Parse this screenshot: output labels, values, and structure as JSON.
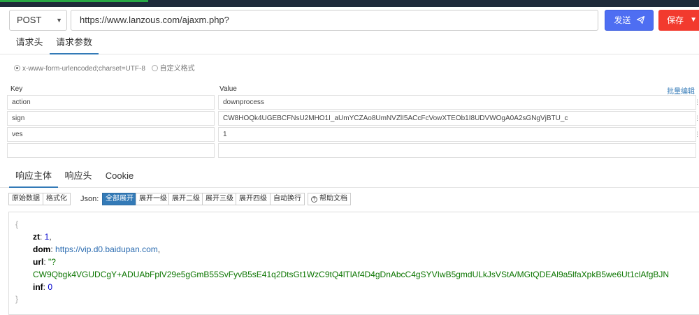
{
  "request": {
    "method": "POST",
    "url": "https://www.lanzous.com/ajaxm.php?",
    "send_label": "发送",
    "save_label": "保存"
  },
  "request_tabs": [
    "请求头",
    "请求参数"
  ],
  "body_types": [
    "x-www-form-urlencoded;charset=UTF-8",
    "自定义格式"
  ],
  "params": {
    "key_header": "Key",
    "value_header": "Value",
    "bulk_edit": "批量编辑",
    "rows": [
      {
        "key": "action",
        "value": "downprocess"
      },
      {
        "key": "sign",
        "value": "CW8HOQk4UGEBCFNsU2MHO1I_aUmYCZAo8UmNVZlI5ACcFcVowXTEOb1I8UDVWOgA0A2sGNgVjBTU_c"
      },
      {
        "key": "ves",
        "value": "1"
      },
      {
        "key": "",
        "value": ""
      }
    ]
  },
  "response_tabs": [
    "响应主体",
    "响应头",
    "Cookie"
  ],
  "view_buttons": [
    "原始数据",
    "格式化"
  ],
  "json_label": "Json:",
  "expand_buttons": [
    "全部展开",
    "展开一级",
    "展开二级",
    "展开三级",
    "展开四级",
    "自动换行"
  ],
  "help_label": "帮助文档",
  "response": {
    "open_brace": "{",
    "close_brace": "}",
    "zt_key": "zt",
    "zt_value": "1",
    "dom_key": "dom",
    "dom_value": "https://vip.d0.baidupan.com",
    "url_key": "url",
    "url_value_open": "\"?",
    "url_value_cont": "CW9Qbgk4VGUDCgY+ADUAbFplV29e5gGmB55SvFyvB5sE41q2DtsGt1WzC9tQ4lTlAf4D4gDnAbcC4gSYVIwB5gmdULkJsVStA/MGtQDEAl9a5lfaXpkB5we6Ut1clAfgBJN",
    "inf_key": "inf",
    "inf_value": "0"
  },
  "colors": {
    "accent": "#337ab7",
    "send_button": "#4e6ef2",
    "save_button": "#f23a2e",
    "json_string": "#0b7500",
    "json_number": "#0000cc"
  }
}
